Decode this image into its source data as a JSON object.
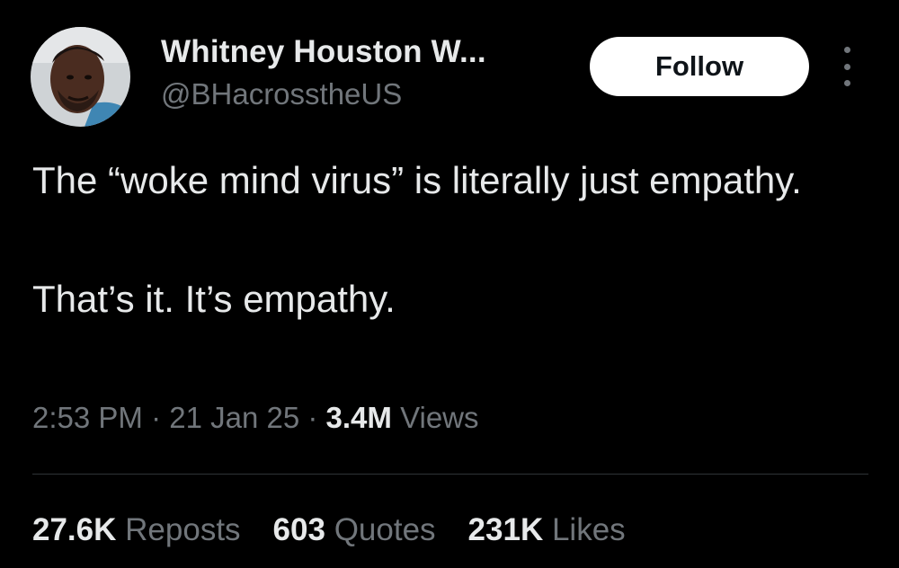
{
  "author": {
    "display_name": "Whitney Houston W...",
    "handle": "@BHacrosstheUS"
  },
  "follow_button": {
    "label": "Follow"
  },
  "tweet": {
    "line1": "The “woke mind virus” is literally just empathy.",
    "line2": "That’s it. It’s empathy."
  },
  "meta": {
    "time": "2:53 PM",
    "separator": " · ",
    "date": "21 Jan 25",
    "views_count": "3.4M",
    "views_label": "Views"
  },
  "stats": {
    "reposts_count": "27.6K",
    "reposts_label": "Reposts",
    "quotes_count": "603",
    "quotes_label": "Quotes",
    "likes_count": "231K",
    "likes_label": "Likes"
  },
  "colors": {
    "background": "#000000",
    "primary_text": "#e7e9ea",
    "secondary_text": "#71767b",
    "divider": "#2f3336",
    "button_bg": "#ffffff"
  },
  "icons": {
    "more": "more-dots-icon"
  }
}
